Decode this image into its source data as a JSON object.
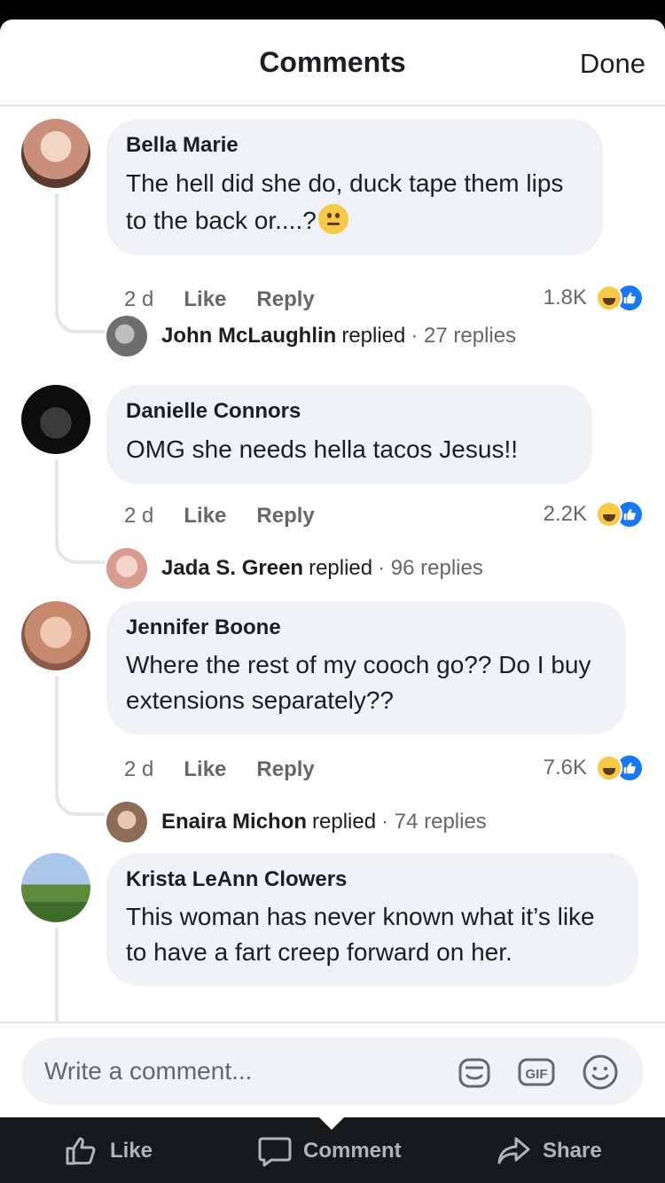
{
  "header": {
    "title": "Comments",
    "done_label": "Done"
  },
  "comments": [
    {
      "author": "Bella Marie",
      "text": "The hell did she do, duck tape them lips to the back or....?",
      "emoji": "slightly-frowning-face",
      "time": "2 d",
      "like_label": "Like",
      "reply_label": "Reply",
      "reaction_count": "1.8K",
      "avatar_color": "#c98f7a",
      "reply": {
        "name": "John McLaughlin",
        "action": "replied",
        "count": "· 27 replies",
        "avatar_color": "#8a8a8a"
      }
    },
    {
      "author": "Danielle Connors",
      "text": "OMG she needs hella tacos Jesus!!",
      "time": "2 d",
      "like_label": "Like",
      "reply_label": "Reply",
      "reaction_count": "2.2K",
      "avatar_color": "#1a1a1a",
      "reply": {
        "name": "Jada S. Green",
        "action": "replied",
        "count": "· 96 replies",
        "avatar_color": "#e8b7b0"
      }
    },
    {
      "author": "Jennifer Boone",
      "text": "Where the rest of my cooch go?? Do I buy extensions separately??",
      "time": "2 d",
      "like_label": "Like",
      "reply_label": "Reply",
      "reaction_count": "7.6K",
      "avatar_color": "#d9a58a",
      "reply": {
        "name": "Enaira Michon",
        "action": "replied",
        "count": "· 74 replies",
        "avatar_color": "#9c7b63"
      }
    },
    {
      "author": "Krista LeAnn Clowers",
      "text": "This woman has never known what it’s like to have a fart creep forward on her.",
      "avatar_color": "#6d8f4e"
    }
  ],
  "composer": {
    "placeholder": "Write a comment...",
    "gif_label": "GIF"
  },
  "bottom_bar": {
    "like": "Like",
    "comment": "Comment",
    "share": "Share"
  },
  "colors": {
    "accent": "#1877f2",
    "bubble": "#f0f2f5",
    "muted": "#65676b"
  }
}
